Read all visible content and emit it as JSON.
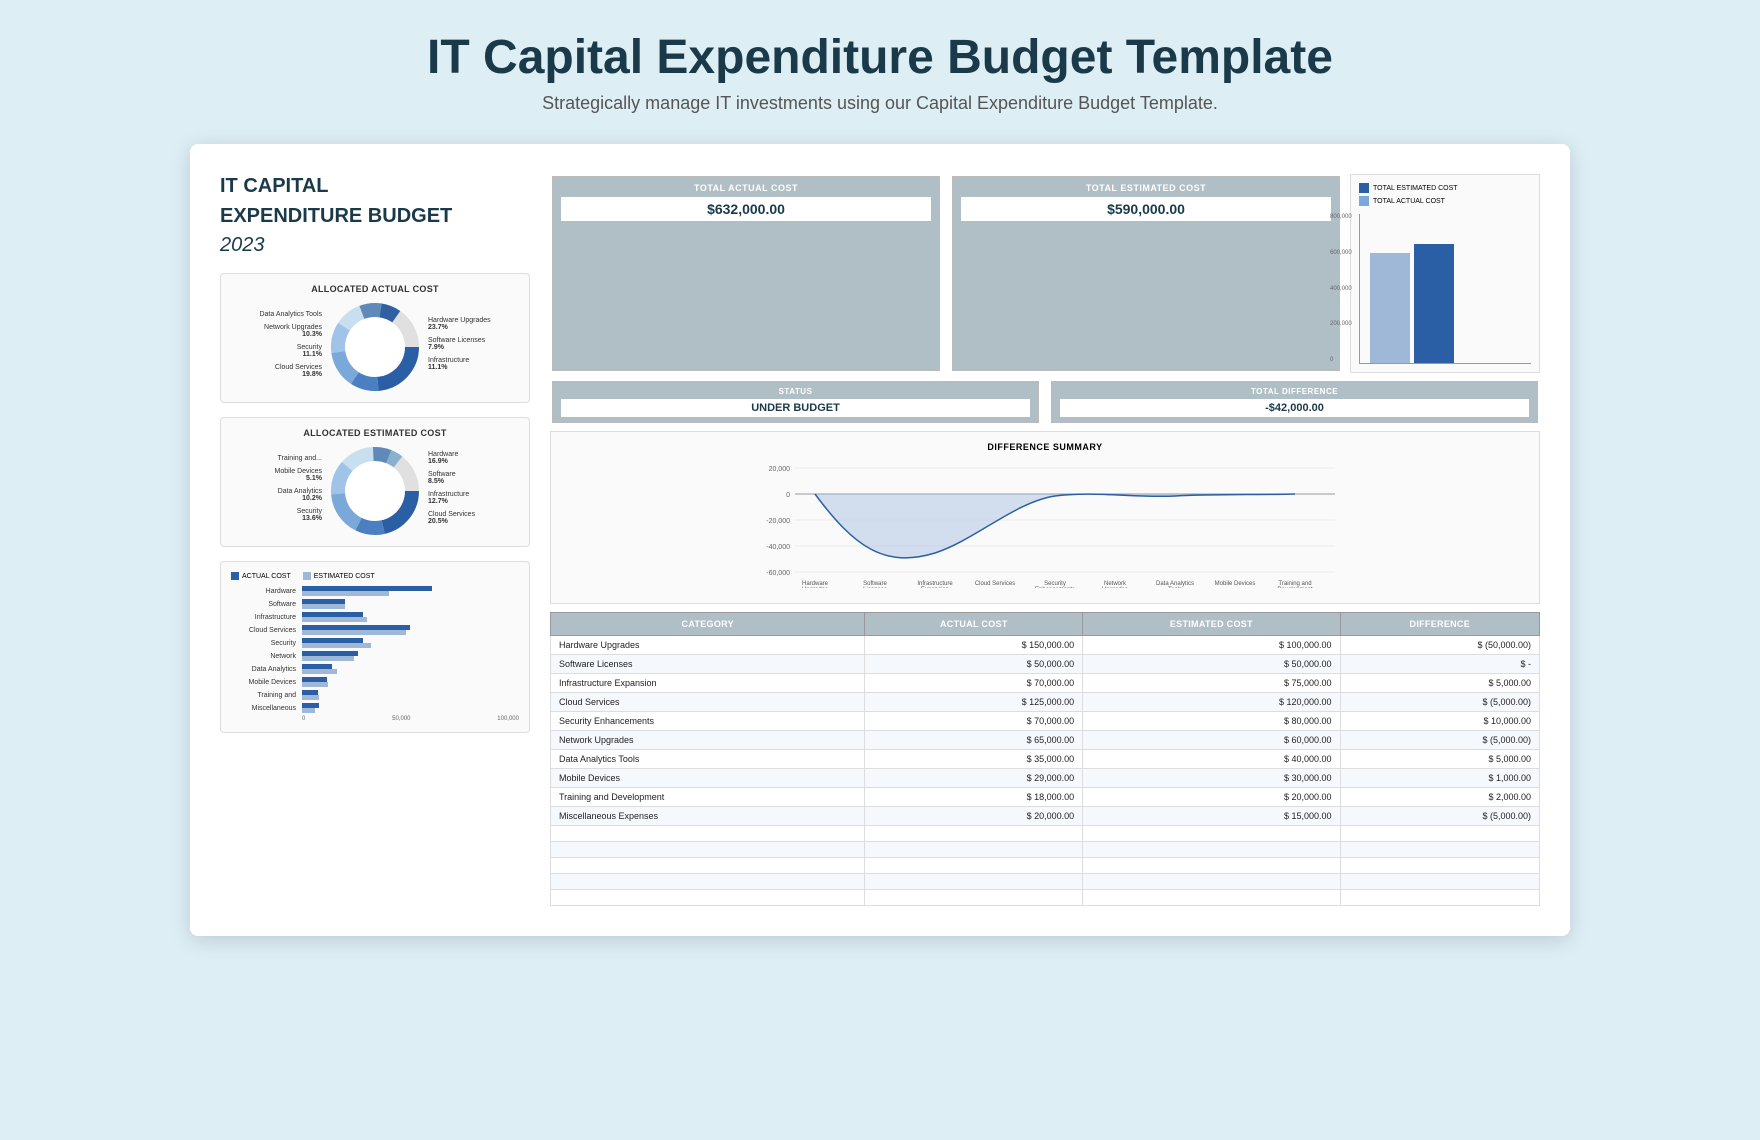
{
  "page": {
    "title": "IT Capital Expenditure Budget Template",
    "subtitle": "Strategically manage IT investments using our Capital Expenditure Budget Template."
  },
  "left": {
    "title_line1": "IT CAPITAL",
    "title_line2": "EXPENDITURE BUDGET",
    "year": "2023",
    "donut1": {
      "title": "ALLOCATED ACTUAL COST",
      "left_labels": [
        {
          "name": "Data Analytics Tools",
          "pct": ""
        },
        {
          "name": "Network Upgrades",
          "pct": "10.3%"
        },
        {
          "name": "Security",
          "pct": "11.1%"
        },
        {
          "name": "Cloud Services",
          "pct": "19.8%"
        }
      ],
      "right_labels": [
        {
          "name": "Hardware Upgrades",
          "pct": "23.7%"
        },
        {
          "name": "Software Licenses",
          "pct": "7.9%"
        },
        {
          "name": "Infrastructure",
          "pct": "11.1%"
        }
      ]
    },
    "donut2": {
      "title": "ALLOCATED ESTIMATED COST",
      "left_labels": [
        {
          "name": "Training and...",
          "pct": ""
        },
        {
          "name": "Mobile Devices",
          "pct": "5.1%"
        },
        {
          "name": "Data Analytics",
          "pct": ""
        },
        {
          "name": "Security",
          "pct": "13.6%"
        }
      ],
      "right_labels": [
        {
          "name": "Hardware",
          "pct": "16.9%"
        },
        {
          "name": "Software",
          "pct": "8.5%"
        },
        {
          "name": "Infrastructure",
          "pct": "12.7%"
        },
        {
          "name": "Cloud Services",
          "pct": "20.5%"
        }
      ]
    },
    "hbar": {
      "title": "",
      "legend_actual": "ACTUAL COST",
      "legend_estimated": "ESTIMATED COST",
      "rows": [
        {
          "label": "Hardware",
          "actual": 150000,
          "estimated": 100000
        },
        {
          "label": "Software",
          "actual": 50000,
          "estimated": 50000
        },
        {
          "label": "Infrastructure",
          "actual": 70000,
          "estimated": 75000
        },
        {
          "label": "Cloud Services",
          "actual": 125000,
          "estimated": 120000
        },
        {
          "label": "Security",
          "actual": 70000,
          "estimated": 80000
        },
        {
          "label": "Network",
          "actual": 65000,
          "estimated": 60000
        },
        {
          "label": "Data Analytics",
          "actual": 35000,
          "estimated": 40000
        },
        {
          "label": "Mobile Devices",
          "actual": 29000,
          "estimated": 30000
        },
        {
          "label": "Training and",
          "actual": 18000,
          "estimated": 20000
        },
        {
          "label": "Miscellaneous",
          "actual": 20000,
          "estimated": 15000
        }
      ],
      "max": 150000,
      "axis_labels": [
        "0",
        "50,000",
        "100,000"
      ]
    }
  },
  "summary": {
    "total_actual_label": "TOTAL ACTUAL COST",
    "total_actual_value": "$632,000.00",
    "total_estimated_label": "TOTAL ESTIMATED COST",
    "total_estimated_value": "$590,000.00",
    "status_label": "STATUS",
    "status_value": "UNDER BUDGET",
    "diff_label": "TOTAL DIFFERENCE",
    "diff_value": "-$42,000.00"
  },
  "diff_chart": {
    "title": "DIFFERENCE SUMMARY",
    "y_labels": [
      "20,000",
      "0",
      "-20,000",
      "-40,000",
      "-60,000"
    ],
    "x_labels": [
      "Hardware\nUpgrades",
      "Software\nLicenses",
      "Infrastructure\nExpansion",
      "Cloud Services",
      "Security\nEnhancements",
      "Network\nUpgrades",
      "Data Analytics\nTools",
      "Mobile Devices",
      "Training and\nDevelopment"
    ]
  },
  "vbar_chart": {
    "legend_estimated": "TOTAL ESTIMATED COST",
    "legend_actual": "TOTAL ACTUAL COST",
    "y_labels": [
      "800,000",
      "600,000",
      "400,000",
      "200,000",
      "0"
    ],
    "estimated_height_pct": 74,
    "actual_height_pct": 80
  },
  "table": {
    "headers": [
      "CATEGORY",
      "ACTUAL COST",
      "ESTIMATED COST",
      "DIFFERENCE"
    ],
    "rows": [
      {
        "category": "Hardware Upgrades",
        "actual": "$ 150,000.00",
        "estimated": "$ 100,000.00",
        "difference": "$ (50,000.00)"
      },
      {
        "category": "Software Licenses",
        "actual": "$  50,000.00",
        "estimated": "$  50,000.00",
        "difference": "$          -"
      },
      {
        "category": "Infrastructure Expansion",
        "actual": "$  70,000.00",
        "estimated": "$  75,000.00",
        "difference": "$   5,000.00"
      },
      {
        "category": "Cloud Services",
        "actual": "$ 125,000.00",
        "estimated": "$ 120,000.00",
        "difference": "$  (5,000.00)"
      },
      {
        "category": "Security Enhancements",
        "actual": "$  70,000.00",
        "estimated": "$  80,000.00",
        "difference": "$  10,000.00"
      },
      {
        "category": "Network Upgrades",
        "actual": "$  65,000.00",
        "estimated": "$  60,000.00",
        "difference": "$  (5,000.00)"
      },
      {
        "category": "Data Analytics Tools",
        "actual": "$  35,000.00",
        "estimated": "$  40,000.00",
        "difference": "$   5,000.00"
      },
      {
        "category": "Mobile Devices",
        "actual": "$  29,000.00",
        "estimated": "$  30,000.00",
        "difference": "$   1,000.00"
      },
      {
        "category": "Training and Development",
        "actual": "$  18,000.00",
        "estimated": "$  20,000.00",
        "difference": "$   2,000.00"
      },
      {
        "category": "Miscellaneous Expenses",
        "actual": "$  20,000.00",
        "estimated": "$  15,000.00",
        "difference": "$  (5,000.00)"
      }
    ]
  }
}
